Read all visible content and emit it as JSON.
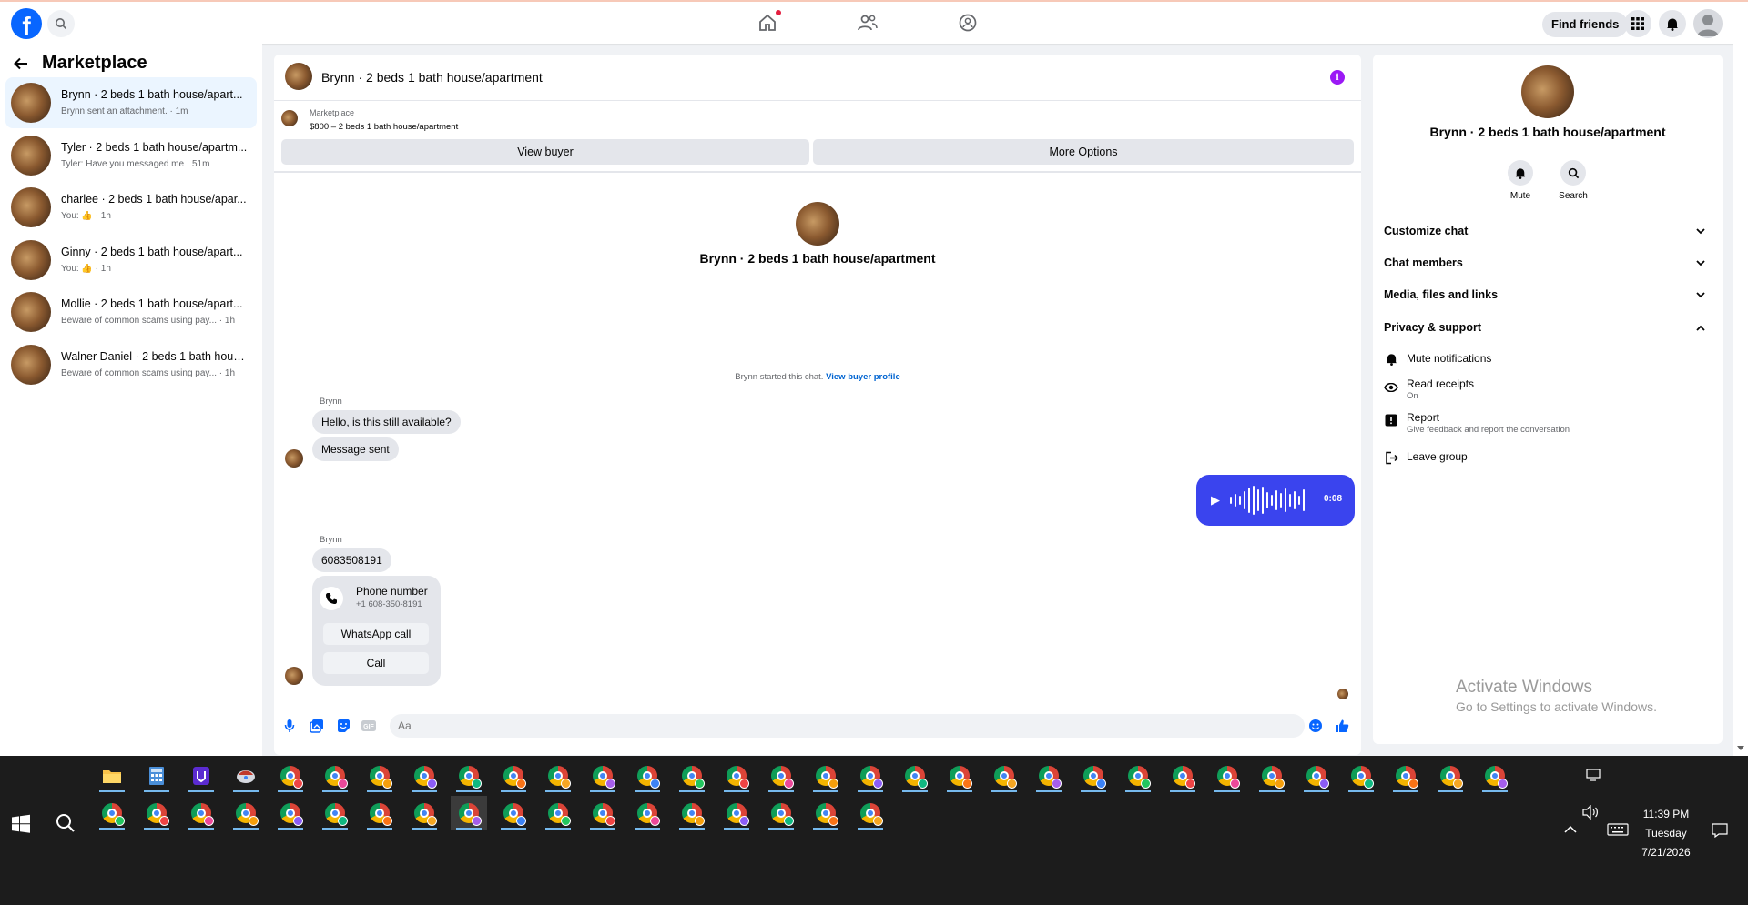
{
  "topbar": {
    "logo": "f",
    "find_friends": "Find friends",
    "icons": [
      "facebook-logo-icon",
      "search-icon",
      "home-icon",
      "friends-icon",
      "groups-icon",
      "menu-grid-icon",
      "bell-icon",
      "account-icon"
    ]
  },
  "sidebar": {
    "title": "Marketplace",
    "conversations": [
      {
        "name": "Brynn · 2 beds 1 bath house/apart...",
        "snippet": "Brynn sent an attachment. · 1m",
        "active": true
      },
      {
        "name": "Tyler · 2 beds 1 bath house/apartm...",
        "snippet": "Tyler: Have you messaged me · 51m"
      },
      {
        "name": "charlee · 2 beds 1 bath house/apar...",
        "snippet": "You: 👍 · 1h"
      },
      {
        "name": "Ginny · 2 beds 1 bath house/apart...",
        "snippet": "You: 👍 · 1h"
      },
      {
        "name": "Mollie · 2 beds 1 bath house/apart...",
        "snippet": "Beware of common scams using pay... · 1h"
      },
      {
        "name": "Walner Daniel · 2 beds 1 bath hous...",
        "snippet": "Beware of common scams using pay... · 1h"
      }
    ]
  },
  "chat": {
    "title": "Brynn · 2 beds 1 bath house/apartment",
    "marketplace_label": "Marketplace",
    "listing": "$800 – 2 beds 1 bath house/apartment",
    "view_buyer": "View buyer",
    "more_options": "More Options",
    "center_name": "Brynn · 2 beds 1 bath house/apartment",
    "started_text": "Brynn started this chat.",
    "view_buyer_profile": "View buyer profile",
    "sender1": "Brynn",
    "msg1": "Hello, is this still available?",
    "msg2": "Message sent",
    "voice_duration": "0:08",
    "sender2": "Brynn",
    "msg3": "6083508191",
    "phone_title": "Phone number",
    "phone_number": "+1 608-350-8191",
    "whatsapp_call": "WhatsApp call",
    "call": "Call",
    "input_placeholder": "Aa"
  },
  "right_panel": {
    "name": "Brynn · 2 beds 1 bath house/apartment",
    "mute": "Mute",
    "search": "Search",
    "sections": [
      "Customize chat",
      "Chat members",
      "Media, files and links",
      "Privacy & support"
    ],
    "mute_notifications": "Mute notifications",
    "read_receipts": "Read receipts",
    "read_receipts_state": "On",
    "report": "Report",
    "report_desc": "Give feedback and report the conversation",
    "leave_group": "Leave group"
  },
  "watermark": {
    "line1": "Activate Windows",
    "line2": "Go to Settings to activate Windows."
  },
  "taskbar": {
    "time": "11:39 PM",
    "day": "Tuesday",
    "date": "7/21/2026"
  },
  "colors": {
    "accent": "#0866ff",
    "voice_bubble": "#3a44ee",
    "info": "#9b19f5",
    "active_conv": "#ebf5ff"
  }
}
